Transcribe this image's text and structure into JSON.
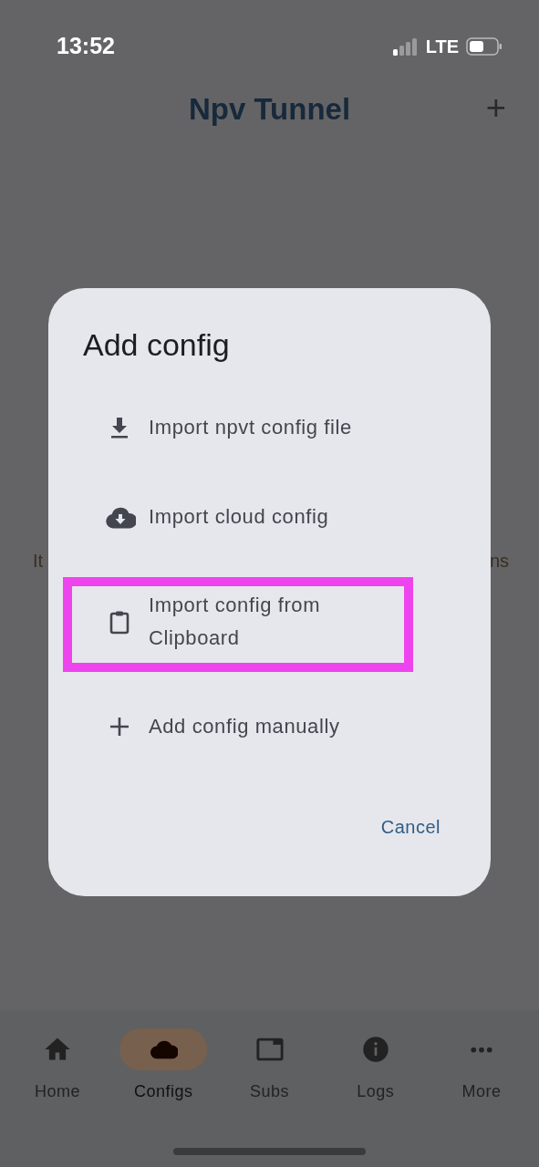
{
  "status_bar": {
    "time": "13:52",
    "network": "LTE"
  },
  "header": {
    "title": "Npv Tunnel",
    "action": "+"
  },
  "background_text": {
    "left": "It",
    "right": "ns"
  },
  "dialog": {
    "title": "Add config",
    "options": [
      {
        "kind": "download",
        "label": "Import npvt config file",
        "highlighted": false
      },
      {
        "kind": "cloud",
        "label": "Import cloud config",
        "highlighted": false
      },
      {
        "kind": "clipboard",
        "label": "Import config from Clipboard",
        "highlighted": true
      },
      {
        "kind": "plus",
        "label": "Add config manually",
        "highlighted": false
      }
    ],
    "cancel": "Cancel"
  },
  "bottom_nav": [
    {
      "kind": "home",
      "label": "Home",
      "selected": false
    },
    {
      "kind": "cloud",
      "label": "Configs",
      "selected": true
    },
    {
      "kind": "window",
      "label": "Subs",
      "selected": false
    },
    {
      "kind": "info",
      "label": "Logs",
      "selected": false
    },
    {
      "kind": "more",
      "label": "More",
      "selected": false
    }
  ]
}
